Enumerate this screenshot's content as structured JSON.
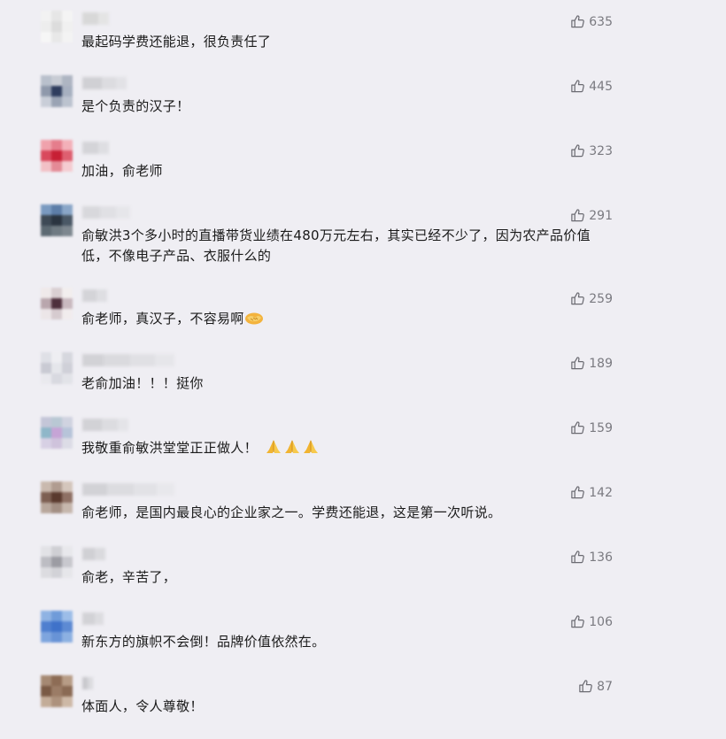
{
  "comments": [
    {
      "text": "最起码学费还能退，很负责任了",
      "likes": "635",
      "avatar": [
        "#f2f2f2",
        "#e6e6e6",
        "#f4f4f4",
        "#ededed",
        "#dcdcdc",
        "#f0f0f0",
        "#f6f6f6",
        "#e8e8e8",
        "#f3f3f3"
      ],
      "nick": [
        "#d8d8d8",
        "#e4e4e4"
      ]
    },
    {
      "text": "是个负责的汉子！",
      "likes": "445",
      "avatar": [
        "#b9c0cc",
        "#c8ccd4",
        "#aeb5c2",
        "#8f99ab",
        "#2f3d5e",
        "#a7b0c0",
        "#c9ced8",
        "#9aa3b4",
        "#bcc3cf"
      ],
      "nick": [
        "#d0d0d4",
        "#dcdce0",
        "#e2e2e6"
      ]
    },
    {
      "text": "加油，俞老师",
      "likes": "323",
      "avatar": [
        "#f0a2ac",
        "#e57d8c",
        "#f3b0b9",
        "#d9495d",
        "#c71f35",
        "#de5f70",
        "#f2c0c6",
        "#e48a96",
        "#f5ccd1"
      ],
      "nick": [
        "#d4d4d8",
        "#dedee2"
      ]
    },
    {
      "text": "俞敏洪3个多小时的直播带货业绩在480万元左右，其实已经不少了，因为农产品价值低，不像电子产品、衣服什么的",
      "likes": "291",
      "avatar": [
        "#7a9ac0",
        "#5d7ea8",
        "#8aa6c8",
        "#3e4a56",
        "#2a3440",
        "#4a5866",
        "#5d6a73",
        "#6f7a82",
        "#7d878f"
      ],
      "nick": [
        "#d8d8dc",
        "#e0e0e4",
        "#e6e6ea"
      ]
    },
    {
      "text": "俞老师，真汉子，不容易啊",
      "likes": "259",
      "avatar": [
        "#efe9ea",
        "#d9cfd2",
        "#f2eeee",
        "#b9a6ad",
        "#4e2f3c",
        "#c9b9bf",
        "#ece6e8",
        "#d6cbcf",
        "#f1eced"
      ],
      "nick": [
        "#d4d4d8",
        "#dedee2"
      ]
    },
    {
      "text": "老俞加油！！！挺你",
      "likes": "189",
      "avatar": [
        "#dfe0e6",
        "#eeeeF2",
        "#d6d7de",
        "#c9cad3",
        "#e5e6eb",
        "#cfd0d8",
        "#e9e9ee",
        "#d8d9e0",
        "#e2e3e8"
      ],
      "nick": [
        "#d2d2d6",
        "#dadade",
        "#e0e0e4",
        "#e6e6ea"
      ]
    },
    {
      "text": "我敬重俞敏洪堂堂正正做人！",
      "likes": "159",
      "avatar": [
        "#c4c6d8",
        "#b9c8d4",
        "#d0d3e0",
        "#8fb7c9",
        "#c6a4d6",
        "#b7c4d9",
        "#d7d0e4",
        "#cfc3dc",
        "#dcdce6"
      ],
      "nick": [
        "#d2d2d6",
        "#dcdce0",
        "#e4e4e8"
      ]
    },
    {
      "text": "俞老师，是国内最良心的企业家之一。学费还能退，这是第一次听说。",
      "likes": "142",
      "avatar": [
        "#c9b9ae",
        "#b09c90",
        "#d4c6bc",
        "#7d5f52",
        "#5a3a2e",
        "#8e7064",
        "#b8a79c",
        "#a38f84",
        "#c6b7ad"
      ],
      "nick": [
        "#d2d2d6",
        "#dcdce0",
        "#e2e2e6",
        "#e8e8ec"
      ]
    },
    {
      "text": "俞老，辛苦了，",
      "likes": "136",
      "avatar": [
        "#e2e2e6",
        "#cfcfd4",
        "#e8e8ec",
        "#bdbdc3",
        "#9c9ca3",
        "#c8c8ce",
        "#dcdce0",
        "#d2d2d7",
        "#e6e6ea"
      ],
      "nick": [
        "#d0d0d4",
        "#dadade"
      ]
    },
    {
      "text": "新东方的旗帜不会倒！品牌价值依然在。",
      "likes": "106",
      "avatar": [
        "#8fb3e3",
        "#6f9bd9",
        "#9cbde8",
        "#4f7fcf",
        "#3f72c9",
        "#5d8ad3",
        "#7ea5de",
        "#6893d6",
        "#8cb0e2"
      ],
      "nick": [
        "#d2d2d6",
        "#dcdce0"
      ]
    },
    {
      "text": "体面人，令人尊敬！",
      "likes": "87",
      "avatar": [
        "#a58973",
        "#8d6c55",
        "#b79c86",
        "#7a5a45",
        "#9b7c66",
        "#8a6a54",
        "#c3ac98",
        "#ad927d",
        "#cdb8a6"
      ],
      "nick": [
        "#c8c8cc",
        "#dadade"
      ]
    }
  ]
}
